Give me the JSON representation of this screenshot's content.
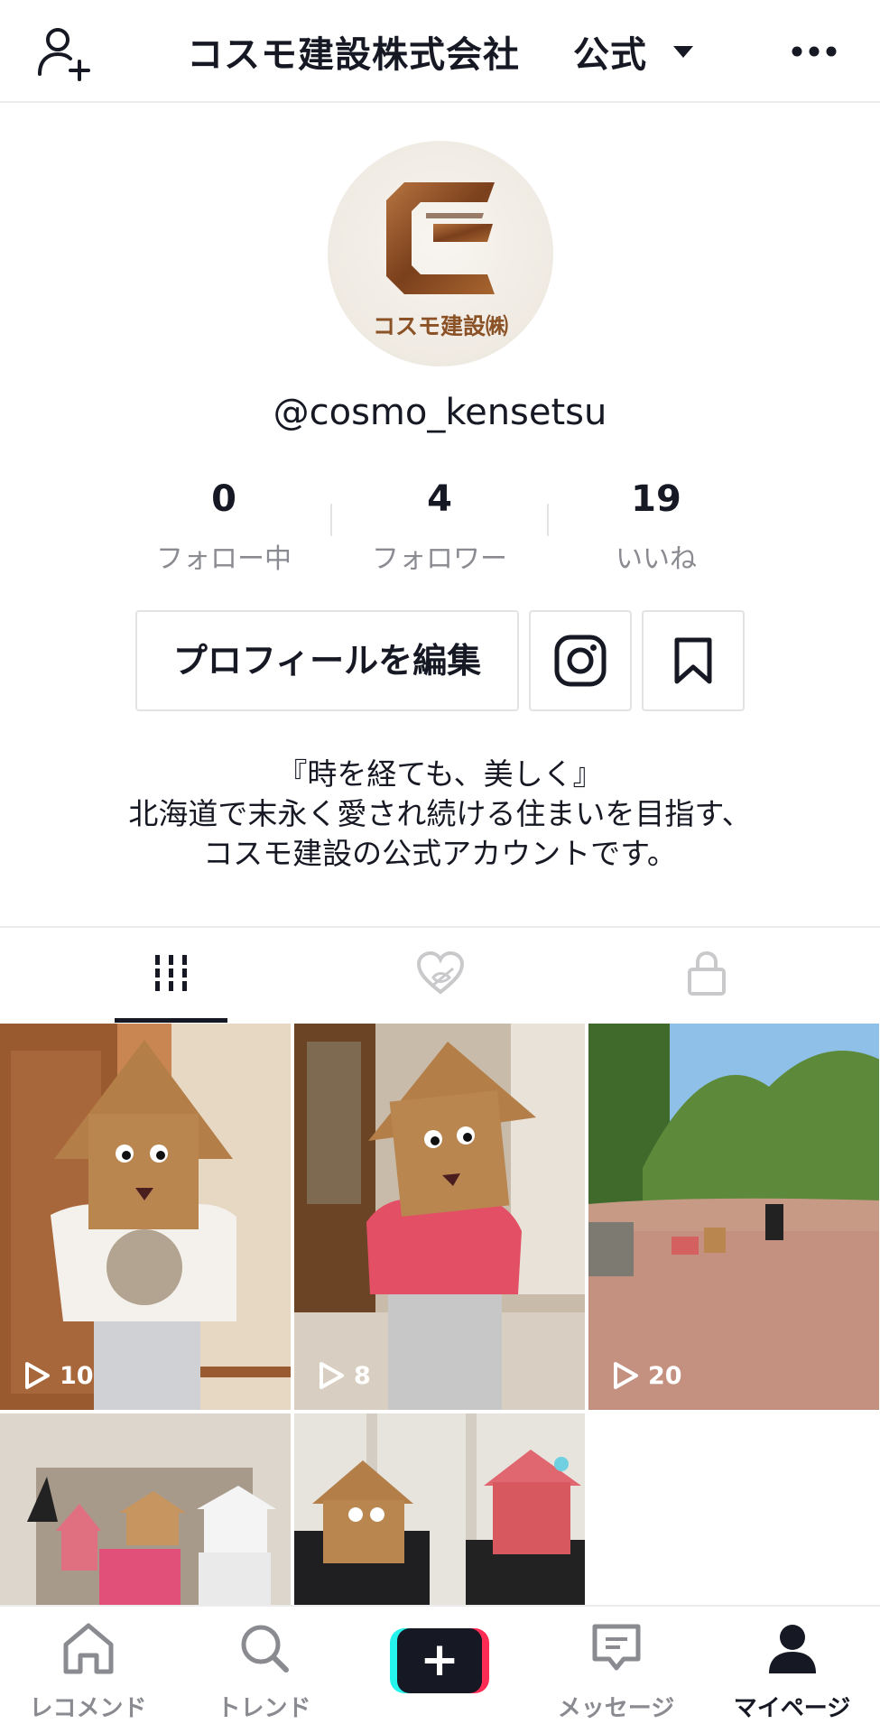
{
  "header": {
    "title": "コスモ建設株式会社",
    "badge": "公式"
  },
  "profile": {
    "avatar_logo_text": "コスモ建設㈱",
    "username": "@cosmo_kensetsu",
    "stats": [
      {
        "value": "0",
        "label": "フォロー中"
      },
      {
        "value": "4",
        "label": "フォロワー"
      },
      {
        "value": "19",
        "label": "いいね"
      }
    ],
    "edit_button_label": "プロフィールを編集",
    "bio": [
      "『時を経ても、美しく』",
      "北海道で末永く愛され続ける住まいを目指す、",
      "コスモ建設の公式アカウントです。"
    ]
  },
  "tabs": [
    {
      "icon": "grid-icon",
      "active": true
    },
    {
      "icon": "liked-hidden-icon",
      "active": false
    },
    {
      "icon": "lock-icon",
      "active": false
    }
  ],
  "videos": [
    {
      "plays": "10"
    },
    {
      "plays": "8"
    },
    {
      "plays": "20"
    },
    {
      "plays": ""
    },
    {
      "plays": ""
    }
  ],
  "bottom_nav": [
    {
      "label": "レコメンド",
      "icon": "home-icon"
    },
    {
      "label": "トレンド",
      "icon": "search-icon"
    },
    {
      "label": "",
      "icon": "create-plus-icon"
    },
    {
      "label": "メッセージ",
      "icon": "message-icon"
    },
    {
      "label": "マイページ",
      "icon": "profile-icon",
      "active": true
    }
  ],
  "colors": {
    "text": "#161823",
    "secondary_text": "#8a8b91",
    "accent_cyan": "#25f4ee",
    "accent_pink": "#fe2c55"
  }
}
